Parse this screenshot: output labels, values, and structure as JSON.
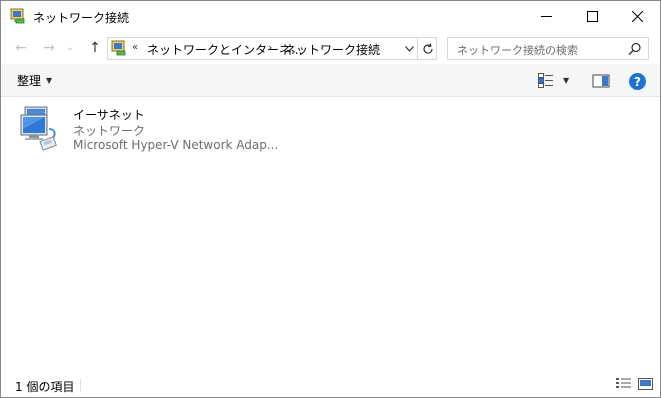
{
  "window": {
    "title": "ネットワーク接続",
    "minimize_glyph": "—",
    "maximize_glyph": "☐",
    "close_glyph": "✕"
  },
  "nav": {
    "back_glyph": "←",
    "forward_glyph": "→",
    "recent_glyph": "⌄",
    "up_glyph": "↑"
  },
  "address": {
    "overflow_glyph": "«",
    "segments": [
      "ネットワークとインターネ...",
      "ネットワーク接続"
    ],
    "separator": "›"
  },
  "search": {
    "placeholder": "ネットワーク接続の検索"
  },
  "commandbar": {
    "organize_label": "整理",
    "caret": "▼",
    "help_label": "?"
  },
  "items": [
    {
      "name": "イーサネット",
      "status": "ネットワーク",
      "device": "Microsoft Hyper-V Network Adap..."
    }
  ],
  "statusbar": {
    "item_count": "1 個の項目"
  },
  "colors": {
    "accent": "#1e73d2",
    "border": "#d9d9d9",
    "secondary_text": "#6d6d6d",
    "commandbar_bg": "#f5f6f7"
  },
  "icons": {
    "app": "network-connections-icon",
    "item": "ethernet-adapter-icon",
    "search": "search-icon",
    "refresh": "refresh-icon",
    "view": "change-view-icon",
    "preview": "preview-pane-icon",
    "details_view": "details-view-icon",
    "tiles_view": "large-icons-view-icon"
  }
}
